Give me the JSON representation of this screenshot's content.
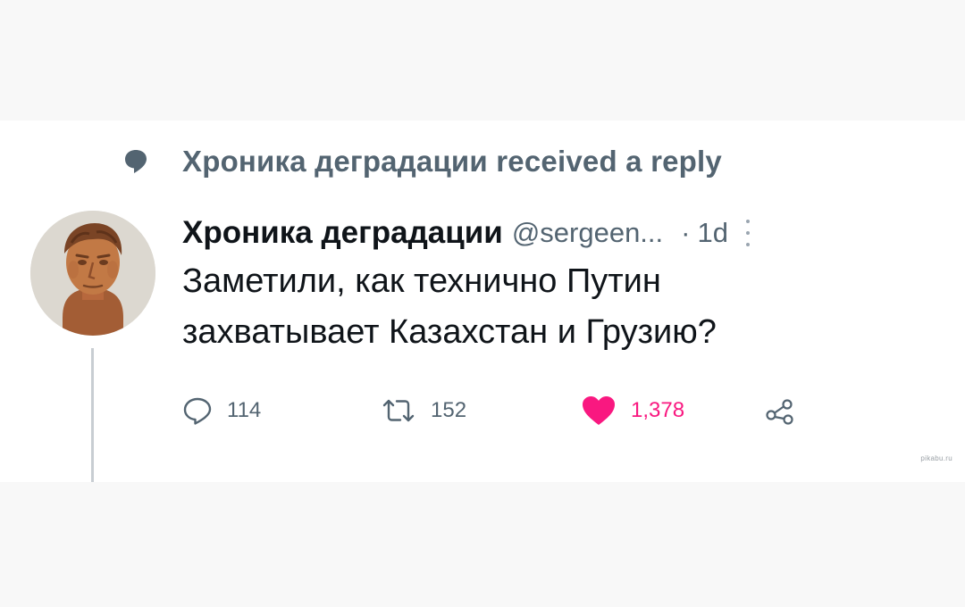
{
  "context": {
    "text": "Хроника деградации received a reply",
    "icon": "speech-bubble-icon"
  },
  "tweet": {
    "display_name": "Хроника деградации",
    "handle": "@sergeen...",
    "separator": "·",
    "time": "1d",
    "text_line1": "Заметили, как технично Путин",
    "text_line2": "захватывает Казахстан и Грузию?",
    "avatar": "roman-bust-avatar"
  },
  "actions": {
    "reply": {
      "icon": "reply-icon",
      "count": "114"
    },
    "retweet": {
      "icon": "retweet-icon",
      "count": "152"
    },
    "like": {
      "icon": "heart-icon",
      "count": "1,378",
      "color": "#f91880"
    },
    "share": {
      "icon": "share-icon"
    }
  },
  "watermark": "pikabu.ru",
  "colors": {
    "text_primary": "#0f1419",
    "text_secondary": "#536471",
    "like": "#f91880",
    "background": "#ffffff"
  }
}
